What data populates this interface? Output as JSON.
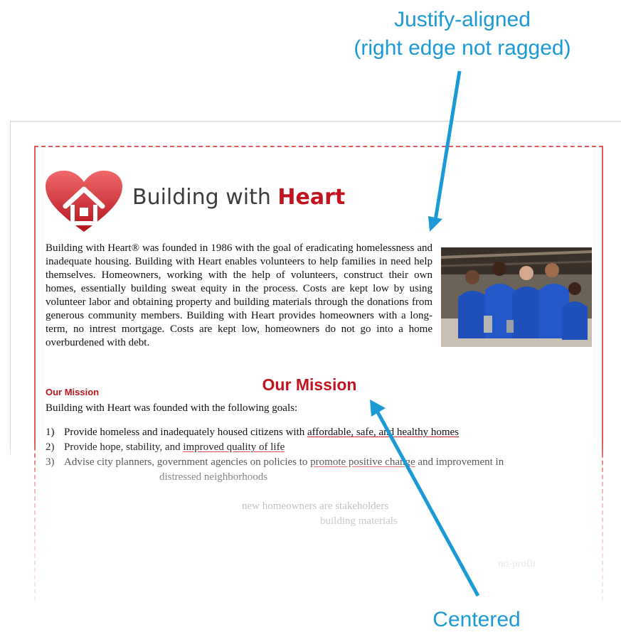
{
  "callouts": {
    "top_line1": "Justify-aligned",
    "top_line2": "(right edge not ragged)",
    "bottom": "Centered",
    "color": "#1b9ad6"
  },
  "document": {
    "logo_icon": "heart-house-icon",
    "title_plain": "Building with ",
    "title_bold": "Heart",
    "brand_color": "#c2141e",
    "intro_paragraph": "Building with Heart® was founded in 1986 with the goal of eradicating homelessness and inadequate housing. Building with Heart enables volunteers to help families in need help themselves. Homeowners, working with the help of volunteers, construct their own homes, essentially building sweat equity in the process. Costs are kept low by using volunteer labor and obtaining property and building materials through the donations from generous community members. Building with Heart provides homeowners with a long-term, no intrest mortgage. Costs are kept low, homeowners do not go into a home overburdened with debt.",
    "photo": "volunteers-group-photo",
    "mission_heading": "Our Mission",
    "mission_heading_centered": "Our Mission",
    "mission_intro": "Building with Heart was founded with the following goals:",
    "goals": [
      {
        "num": "1)",
        "before": "Provide homeless and inadequately housed citizens with ",
        "underlined": "affordable, safe, and healthy homes",
        "after": ""
      },
      {
        "num": "2)",
        "before": "Provide hope, stability, and ",
        "underlined": "improved quality of life",
        "after": ""
      },
      {
        "num": "3)",
        "before": "Advise city planners, government agencies on policies to ",
        "underlined": "promote positive change",
        "after": " and improvement in"
      }
    ],
    "goal3_continuation": "distressed neighborhoods",
    "faint_line_1": "new homeowners are stakeholders",
    "faint_line_2": "building materials",
    "faint_line_3": "no-profit"
  }
}
